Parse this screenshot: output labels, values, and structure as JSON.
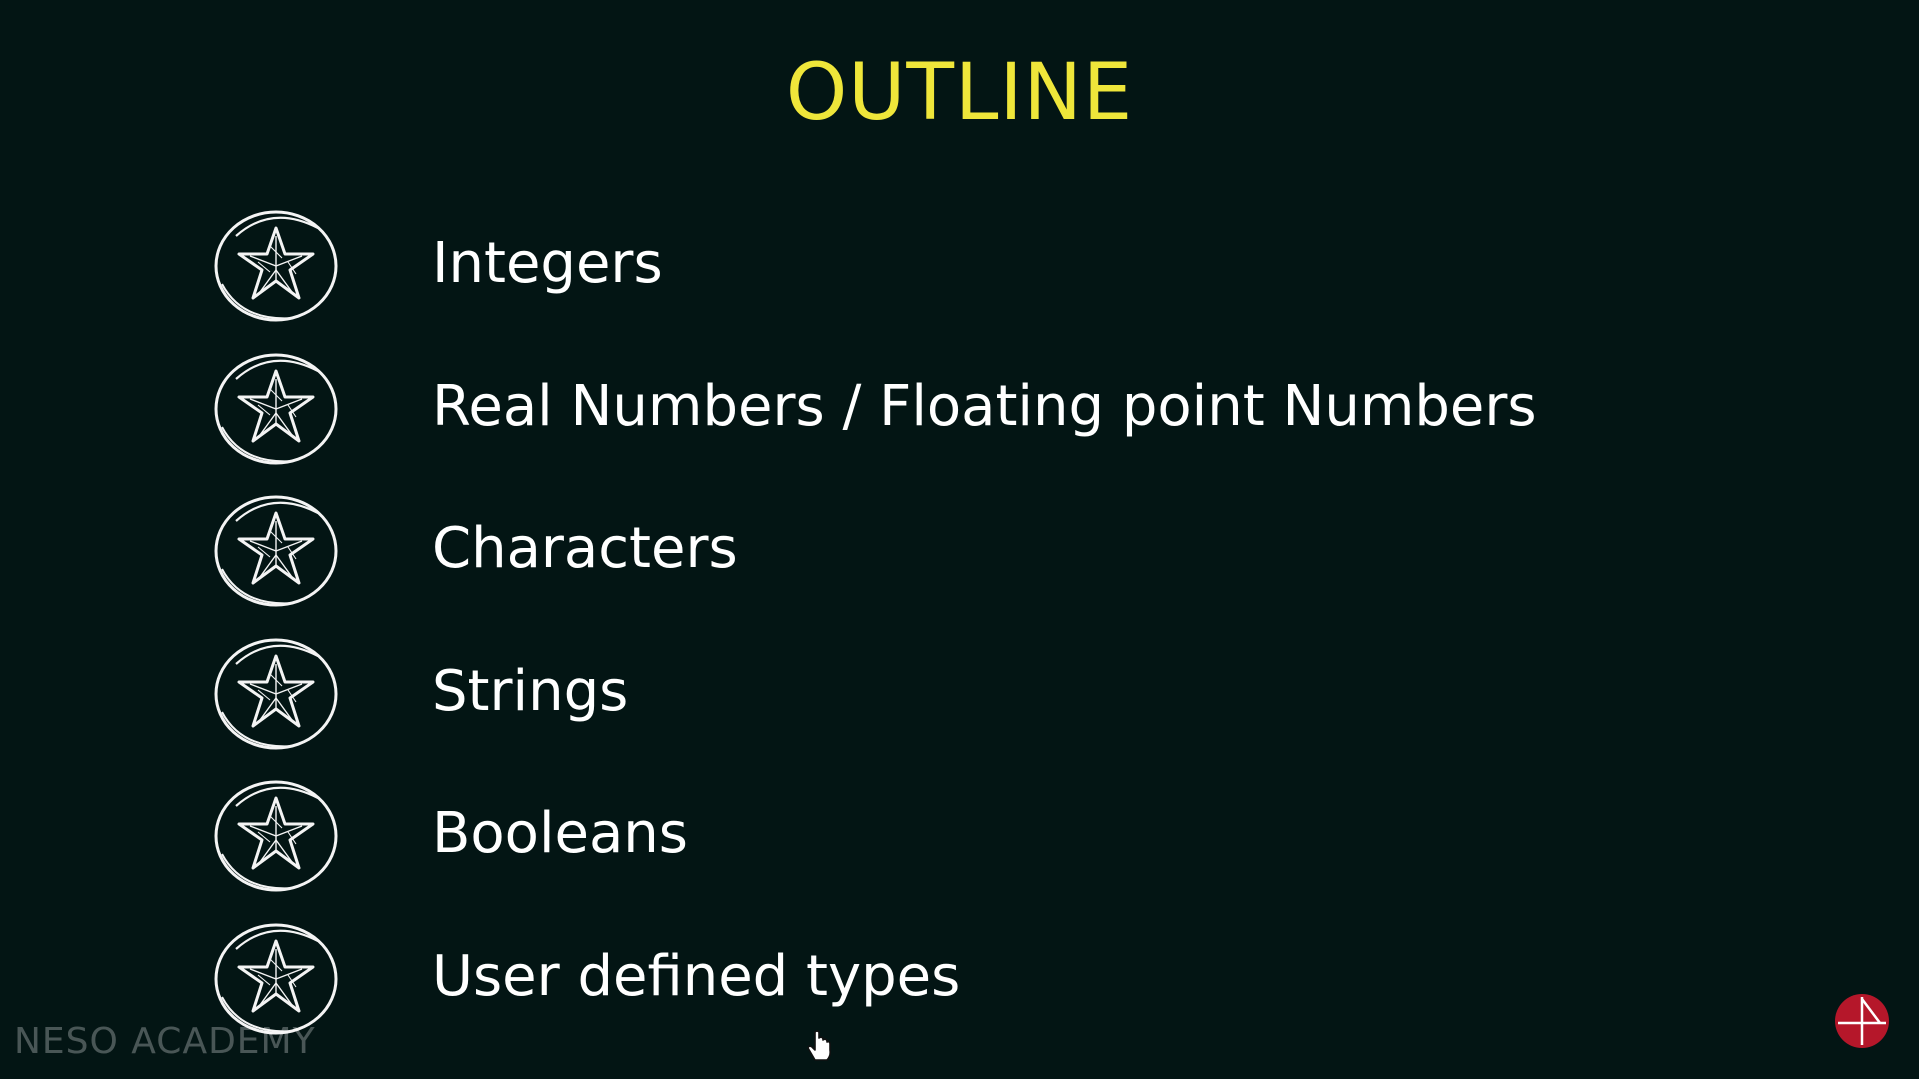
{
  "slide": {
    "title": "OUTLINE",
    "items": [
      {
        "label": "Integers",
        "icon": "star-badge-icon"
      },
      {
        "label": "Real Numbers / Floating point Numbers",
        "icon": "star-badge-icon"
      },
      {
        "label": "Characters",
        "icon": "star-badge-icon"
      },
      {
        "label": "Strings",
        "icon": "star-badge-icon"
      },
      {
        "label": "Booleans",
        "icon": "star-badge-icon"
      },
      {
        "label": "User defined types",
        "icon": "star-badge-icon"
      }
    ],
    "watermark": "NESO ACADEMY"
  },
  "colors": {
    "background": "#031514",
    "title": "#efe63a",
    "text": "#ffffff",
    "logo": "#b5172a"
  }
}
